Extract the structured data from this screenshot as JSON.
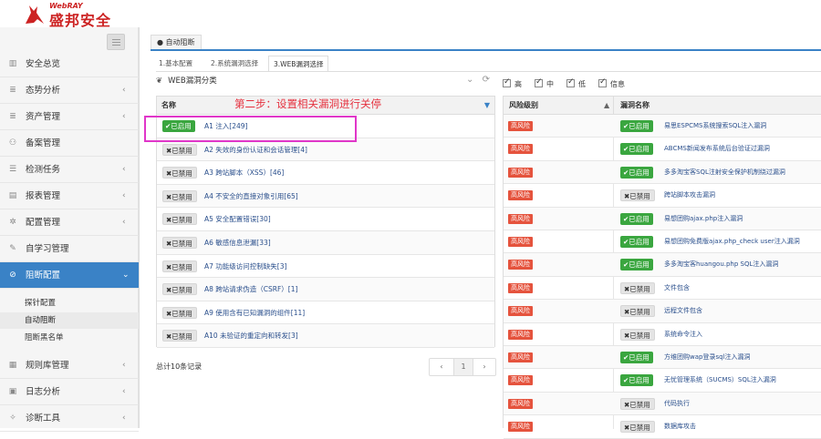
{
  "brand": {
    "en": "WebRAY",
    "cn": "盛邦安全"
  },
  "sidebar": {
    "items": [
      {
        "label": "安全总览",
        "icon": "chart-bar-icon",
        "glyph": "▥",
        "arrow": ""
      },
      {
        "label": "态势分析",
        "icon": "list-icon",
        "glyph": "≣",
        "arrow": "‹"
      },
      {
        "label": "资产管理",
        "icon": "list-icon",
        "glyph": "≣",
        "arrow": "‹"
      },
      {
        "label": "备案管理",
        "icon": "sitemap-icon",
        "glyph": "⚇",
        "arrow": ""
      },
      {
        "label": "检测任务",
        "icon": "tasks-icon",
        "glyph": "☰",
        "arrow": "‹"
      },
      {
        "label": "报表管理",
        "icon": "report-icon",
        "glyph": "▤",
        "arrow": "‹"
      },
      {
        "label": "配置管理",
        "icon": "gear-icon",
        "glyph": "✲",
        "arrow": "‹"
      },
      {
        "label": "自学习管理",
        "icon": "edit-icon",
        "glyph": "✎",
        "arrow": ""
      },
      {
        "label": "阻断配置",
        "icon": "block-icon",
        "glyph": "⊘",
        "arrow": "⌄"
      },
      {
        "label": "规则库管理",
        "icon": "book-icon",
        "glyph": "▦",
        "arrow": "‹"
      },
      {
        "label": "日志分析",
        "icon": "calendar-icon",
        "glyph": "▣",
        "arrow": "‹"
      },
      {
        "label": "诊断工具",
        "icon": "wrench-icon",
        "glyph": "✧",
        "arrow": "‹"
      }
    ],
    "submenu": [
      "探针配置",
      "自动阻断",
      "阻断黑名单"
    ]
  },
  "tab": {
    "icon": "drop-icon",
    "label": "自动阻断"
  },
  "steps": [
    "1.基本配置",
    "2.系统漏洞选择",
    "3.WEB漏洞选择"
  ],
  "category_title": "WEB漏洞分类",
  "filters": [
    "高",
    "中",
    "低",
    "信息"
  ],
  "left_table": {
    "header": "名称",
    "rows": [
      {
        "status": "已启用",
        "enabled": true,
        "name": "A1 注入[249]"
      },
      {
        "status": "已禁用",
        "enabled": false,
        "name": "A2 失效的身份认证和会话管理[4]"
      },
      {
        "status": "已禁用",
        "enabled": false,
        "name": "A3 跨站脚本（XSS）[46]"
      },
      {
        "status": "已禁用",
        "enabled": false,
        "name": "A4 不安全的直接对象引用[65]"
      },
      {
        "status": "已禁用",
        "enabled": false,
        "name": "A5 安全配置错误[30]"
      },
      {
        "status": "已禁用",
        "enabled": false,
        "name": "A6 敏感信息泄漏[33]"
      },
      {
        "status": "已禁用",
        "enabled": false,
        "name": "A7 功能级访问控制缺失[3]"
      },
      {
        "status": "已禁用",
        "enabled": false,
        "name": "A8 跨站请求伪造（CSRF）[1]"
      },
      {
        "status": "已禁用",
        "enabled": false,
        "name": "A9 使用含有已知漏洞的组件[11]"
      },
      {
        "status": "已禁用",
        "enabled": false,
        "name": "A10 未验证的重定向和转发[3]"
      }
    ]
  },
  "annotation": "第二步：设置相关漏洞进行关停",
  "total": "总计10条记录",
  "pager": {
    "prev": "‹",
    "page": "1",
    "next": "›"
  },
  "right_table": {
    "headers": [
      "风险级别",
      "漏洞名称"
    ],
    "rows": [
      {
        "risk": "高风险",
        "status": "已启用",
        "enabled": true,
        "name": "易思ESPCMS系统搜索SQL注入漏洞"
      },
      {
        "risk": "高风险",
        "status": "已启用",
        "enabled": true,
        "name": "ABCMS新闻发布系统后台验证过漏洞"
      },
      {
        "risk": "高风险",
        "status": "已启用",
        "enabled": true,
        "name": "多多淘宝客SQL注射安全保护机制绕过漏洞"
      },
      {
        "risk": "高风险",
        "status": "已禁用",
        "enabled": false,
        "name": "跨站脚本攻击漏洞"
      },
      {
        "risk": "高风险",
        "status": "已启用",
        "enabled": true,
        "name": "易想团购ajax.php注入漏洞"
      },
      {
        "risk": "高风险",
        "status": "已启用",
        "enabled": true,
        "name": "易想团购免费版ajax.php_check user注入漏洞"
      },
      {
        "risk": "高风险",
        "status": "已启用",
        "enabled": true,
        "name": "多多淘宝客huangou.php SQL注入漏洞"
      },
      {
        "risk": "高风险",
        "status": "已禁用",
        "enabled": false,
        "name": "文件包含"
      },
      {
        "risk": "高风险",
        "status": "已禁用",
        "enabled": false,
        "name": "远程文件包含"
      },
      {
        "risk": "高风险",
        "status": "已禁用",
        "enabled": false,
        "name": "系统命令注入"
      },
      {
        "risk": "高风险",
        "status": "已启用",
        "enabled": true,
        "name": "方维团购wap登录sql注入漏洞"
      },
      {
        "risk": "高风险",
        "status": "已启用",
        "enabled": true,
        "name": "无忧管理系统（SUCMS）SQL注入漏洞"
      },
      {
        "risk": "高风险",
        "status": "已禁用",
        "enabled": false,
        "name": "代码执行"
      },
      {
        "risk": "高风险",
        "status": "已禁用",
        "enabled": false,
        "name": "数据库攻击"
      }
    ]
  },
  "colors": {
    "accent": "#3a82c6",
    "enabled": "#3aa63f",
    "risk_high": "#e5533d",
    "annotation": "#e5313f",
    "highlight": "#e036c9"
  }
}
